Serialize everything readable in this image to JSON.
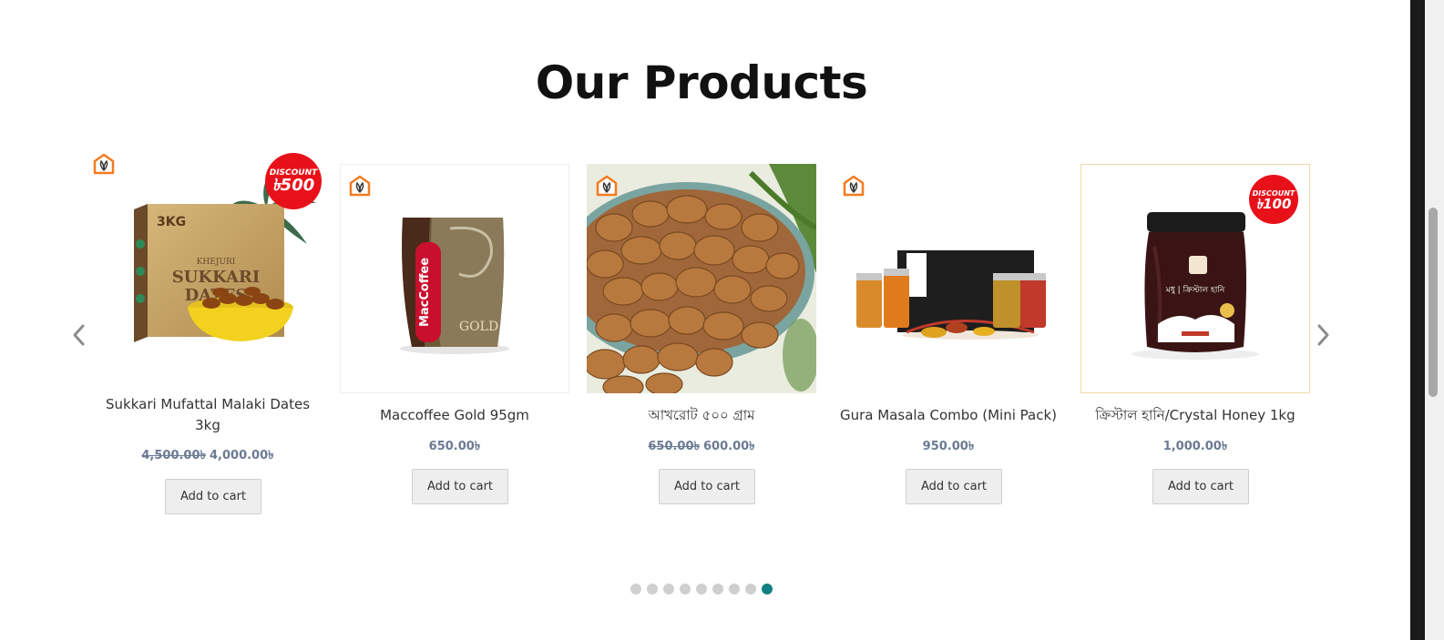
{
  "section": {
    "title": "Our Products"
  },
  "carousel": {
    "prev_icon": "chevron-left-icon",
    "next_icon": "chevron-right-icon",
    "dots_count": 9,
    "active_dot": 9
  },
  "products": [
    {
      "name": "Sukkari Mufattal Malaki Dates 3kg",
      "old_price": "4,500.00৳",
      "price": "4,000.00৳",
      "button": "Add to cart",
      "badge": {
        "label": "DISCOUNT",
        "amount": "৳500"
      },
      "box": {
        "size": "3KG",
        "brand": "KHEJURI",
        "line1": "SUKKARI",
        "line2": "DATES"
      }
    },
    {
      "name": "Maccoffee Gold 95gm",
      "old_price": "",
      "price": "650.00৳",
      "button": "Add to cart",
      "pack": {
        "brand": "MacCoffee",
        "line": "GOLD"
      }
    },
    {
      "name": "আখরোট ৫০০ গ্রাম",
      "old_price": "650.00৳",
      "price": "600.00৳",
      "button": "Add to cart"
    },
    {
      "name": "Gura Masala Combo (Mini Pack)",
      "old_price": "",
      "price": "950.00৳",
      "button": "Add to cart"
    },
    {
      "name": "ক্রিস্টাল হানি/Crystal Honey 1kg",
      "old_price": "",
      "price": "1,000.00৳",
      "button": "Add to cart",
      "badge": {
        "label": "DISCOUNT",
        "amount": "৳100"
      },
      "jar": {
        "label": "মধু | ক্রিস্টাল হানি"
      }
    }
  ],
  "colors": {
    "accent": "#13807f",
    "badge": "#e8111a",
    "brand": "#f47b20"
  }
}
